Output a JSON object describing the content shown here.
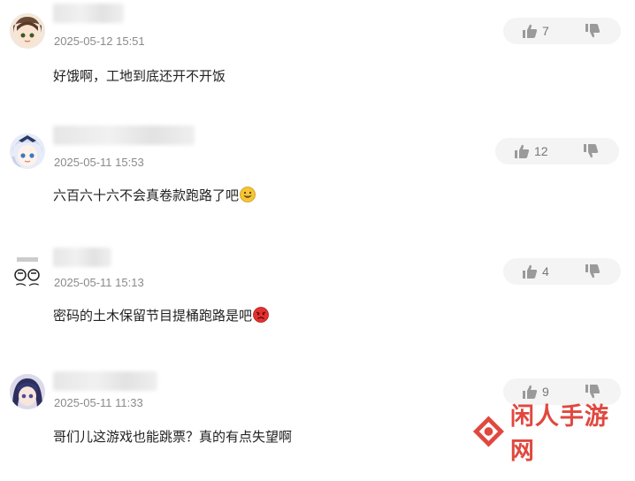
{
  "comments": [
    {
      "timestamp": "2025-05-12 15:51",
      "text": "好饿啊，工地到底还开不开饭",
      "likes": "7",
      "emoji": ""
    },
    {
      "timestamp": "2025-05-11 15:53",
      "text": "六百六十六不会真卷款跑路了吧",
      "likes": "12",
      "emoji": "grinning-face"
    },
    {
      "timestamp": "2025-05-11 15:13",
      "text": "密码的土木保留节目提桶跑路是吧",
      "likes": "4",
      "emoji": "angry-face"
    },
    {
      "timestamp": "2025-05-11 11:33",
      "text": "哥们儿这游戏也能跳票？真的有点失望啊",
      "likes": "9",
      "emoji": ""
    }
  ],
  "watermark": {
    "text": "闲人手游网"
  },
  "icons": {
    "like": "thumbs-up-icon",
    "dislike": "thumbs-down-icon"
  },
  "colors": {
    "watermark": "#e0483f",
    "vote_bg": "#f4f4f4",
    "timestamp": "#8a8a8a"
  }
}
